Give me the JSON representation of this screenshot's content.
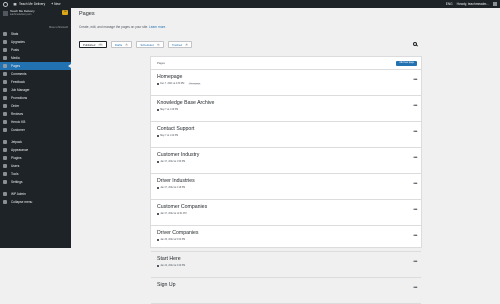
{
  "adminbar": {
    "site_title": "Teach Me Delivery",
    "new_label": "New",
    "lang": "ENG",
    "greeting": "Howdy, teachmeadm..."
  },
  "site": {
    "name": "Teach Me Delivery",
    "sub": "teachmedelivery.com",
    "chip": "TM",
    "switch": "Move to Microsoft"
  },
  "menu": [
    {
      "label": "Stats"
    },
    {
      "label": "Upgrades"
    },
    {
      "label": "Posts"
    },
    {
      "label": "Media"
    },
    {
      "label": "Pages"
    },
    {
      "label": "Comments"
    },
    {
      "label": "Feedback"
    },
    {
      "label": "Job Manager"
    },
    {
      "label": "Promotions"
    },
    {
      "label": "Order"
    },
    {
      "label": "Reviews"
    },
    {
      "label": "Heroic KB"
    },
    {
      "label": "Customer"
    },
    {
      "label": "Jetpack"
    },
    {
      "label": "Appearance"
    },
    {
      "label": "Plugins"
    },
    {
      "label": "Users"
    },
    {
      "label": "Tools"
    },
    {
      "label": "Settings"
    },
    {
      "label": "WP Admin"
    },
    {
      "label": "Collapse menu"
    }
  ],
  "page": {
    "title": "Pages",
    "subtitle": "Create, edit, and manage the pages on your site.",
    "learn_more": "Learn more."
  },
  "tabs": [
    {
      "label": "Published",
      "count": "26"
    },
    {
      "label": "Drafts",
      "count": "1"
    },
    {
      "label": "Scheduled",
      "count": "0"
    },
    {
      "label": "Trashed",
      "count": "0"
    }
  ],
  "panel": {
    "header": "Pages",
    "add_button": "Add new page"
  },
  "rows": [
    {
      "title": "Homepage",
      "meta": "Dec 7, 2021 at 4:39 PM",
      "badge": "Homepage"
    },
    {
      "title": "Knowledge Base Archive",
      "meta": "May 7 at 1:40 PM"
    },
    {
      "title": "Contact Support",
      "meta": "May 7 at 1:42 PM"
    },
    {
      "title": "Customer Industry",
      "meta": "Jan 27, 2022 at 1:50 PM"
    },
    {
      "title": "Driver Industries",
      "meta": "Jan 27, 2022 at 4:18 PM"
    },
    {
      "title": "Customer Companies",
      "meta": "Jan 27, 2022 at 12:01 PM"
    },
    {
      "title": "Driver Companies",
      "meta": "Jan 26, 2022 at 5:02 PM"
    },
    {
      "title": "Start Here",
      "meta": "Jan 24, 2022 at 3:20 PM"
    },
    {
      "title": "Sign Up",
      "meta": ""
    }
  ],
  "colors": {
    "accent": "#2271b1",
    "sidebar": "#1d2327",
    "background": "#f0f0f1"
  }
}
